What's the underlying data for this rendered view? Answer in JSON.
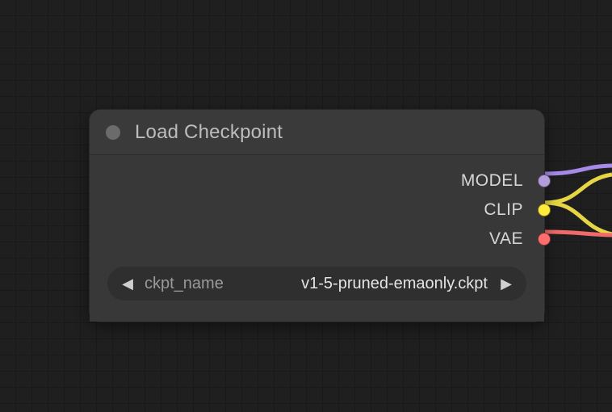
{
  "node": {
    "title": "Load Checkpoint",
    "outputs": [
      {
        "label": "MODEL",
        "color": "#b39ddb"
      },
      {
        "label": "CLIP",
        "color": "#ffeb3b"
      },
      {
        "label": "VAE",
        "color": "#ff6e6e"
      }
    ],
    "widget": {
      "label": "ckpt_name",
      "value": "v1-5-pruned-emaonly.ckpt"
    }
  },
  "wires": [
    {
      "color": "#a58ae8"
    },
    {
      "color": "#e6d544"
    },
    {
      "color": "#e6d544"
    },
    {
      "color": "#f06a6a"
    }
  ]
}
